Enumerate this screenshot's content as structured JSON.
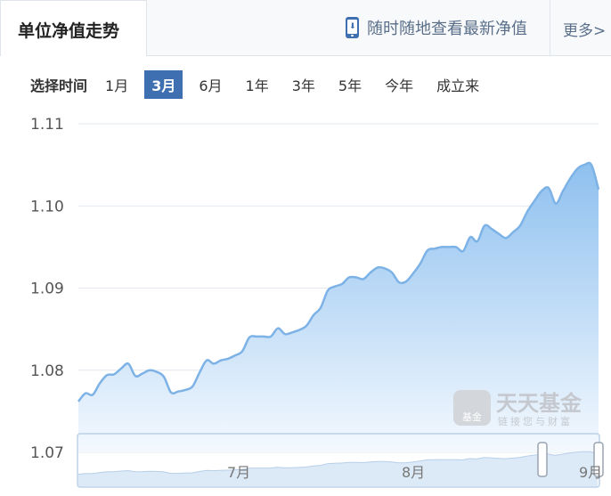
{
  "header": {
    "active_tab": "单位净值走势",
    "mobile_link": "随时随地查看最新净值",
    "more_link": "更多>"
  },
  "range_selector": {
    "label": "选择时间",
    "options": [
      "1月",
      "3月",
      "6月",
      "1年",
      "3年",
      "5年",
      "今年",
      "成立来"
    ],
    "selected": "3月"
  },
  "watermark": {
    "brand": "天天基金",
    "slogan": "链接您与财富",
    "badge": "基金"
  },
  "navigator": {
    "month_labels": [
      "7月",
      "8月",
      "9月"
    ]
  },
  "colors": {
    "accent": "#3e6fb0",
    "line": "#7db2e6",
    "fill_top": "#8ec0ef",
    "fill_bottom": "#f4f9fe"
  },
  "chart_data": {
    "type": "area",
    "title": "",
    "xlabel": "",
    "ylabel": "",
    "ylim": [
      1.07,
      1.11
    ],
    "yticks": [
      1.07,
      1.08,
      1.09,
      1.1,
      1.11
    ],
    "grid": true,
    "legend": "none",
    "series": [
      {
        "name": "",
        "values": [
          1.0762,
          1.0772,
          1.077,
          1.0784,
          1.0794,
          1.0795,
          1.0802,
          1.0808,
          1.0793,
          1.0796,
          1.08,
          1.0798,
          1.0792,
          1.0773,
          1.0774,
          1.0776,
          1.078,
          1.0797,
          1.0812,
          1.0808,
          1.0812,
          1.0814,
          1.0818,
          1.0823,
          1.084,
          1.0841,
          1.0841,
          1.0841,
          1.0851,
          1.0844,
          1.0846,
          1.0849,
          1.0854,
          1.0867,
          1.0876,
          1.0897,
          1.0902,
          1.0905,
          1.0913,
          1.0913,
          1.0911,
          1.0919,
          1.0925,
          1.0924,
          1.0919,
          1.0907,
          1.0908,
          1.0918,
          1.093,
          1.0946,
          1.0948,
          1.095,
          1.095,
          1.095,
          1.0945,
          1.0962,
          1.0957,
          1.0976,
          1.0972,
          1.0966,
          1.0961,
          1.0968,
          1.0976,
          1.0993,
          1.1006,
          1.1018,
          1.1022,
          1.1003,
          1.1018,
          1.1033,
          1.1045,
          1.105,
          1.105,
          1.102
        ]
      }
    ]
  }
}
